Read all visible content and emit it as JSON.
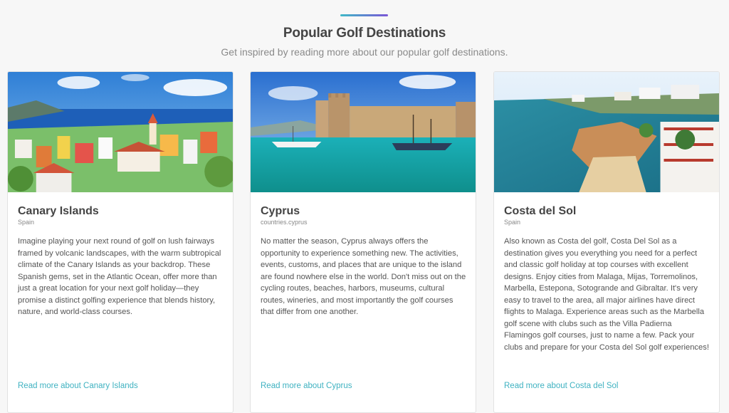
{
  "header": {
    "title": "Popular Golf Destinations",
    "subtitle": "Get inspired by reading more about our popular golf destinations."
  },
  "cards": [
    {
      "title": "Canary Islands",
      "meta": "Spain",
      "description": "Imagine playing your next round of golf on lush fairways framed by volcanic landscapes, with the warm subtropical climate of the Canary Islands as your backdrop. These Spanish gems, set in the Atlantic Ocean, offer more than just a great location for your next golf holiday—they promise a distinct golfing experience that blends history, nature, and world-class courses.",
      "link": "Read more about Canary Islands"
    },
    {
      "title": "Cyprus",
      "meta": "countries.cyprus",
      "description": "No matter the season, Cyprus always offers the opportunity to experience something new. The activities, events, customs, and places that are unique to the island are found nowhere else in the world. Don't miss out on the cycling routes, beaches, harbors, museums, cultural routes, wineries, and most importantly the golf courses that differ from one another.",
      "link": "Read more about Cyprus"
    },
    {
      "title": "Costa del Sol",
      "meta": "Spain",
      "description": "Also known as Costa del golf, Costa Del Sol as a destination gives you everything you need for a perfect and classic golf holiday at top courses with excellent designs. Enjoy cities from Malaga, Mijas, Torremolinos, Marbella, Estepona, Sotogrande and Gibraltar. It's very easy to travel to the area, all major airlines have direct flights to Malaga. Experience areas such as the Marbella golf scene with clubs such as the Villa Padierna Flamingos golf courses, just to name a few. Pack your clubs and prepare for your Costa del Sol golf experiences!",
      "link": "Read more about Costa del Sol"
    }
  ],
  "colors": {
    "accent_start": "#3fb9c7",
    "accent_end": "#7a56d6",
    "link": "#3fb2c1"
  }
}
